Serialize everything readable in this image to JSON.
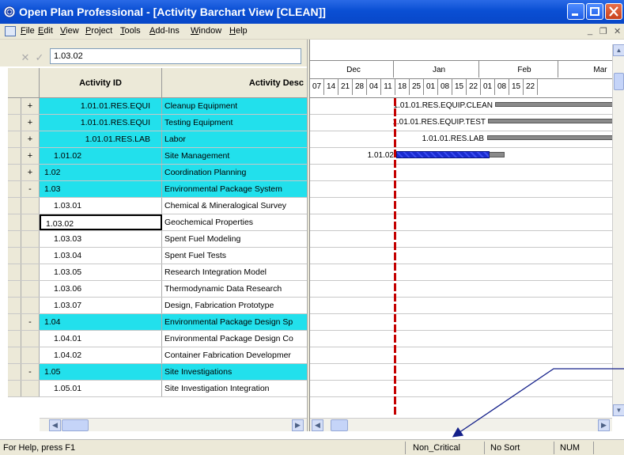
{
  "window": {
    "title": "Open Plan Professional - [Activity Barchart View [CLEAN]]"
  },
  "menu": [
    "File",
    "Edit",
    "View",
    "Project",
    "Tools",
    "Add-Ins",
    "Window",
    "Help"
  ],
  "editbar": {
    "cancel_icon": "x-icon",
    "confirm_icon": "check-icon",
    "value": "1.03.02"
  },
  "grid": {
    "headers": {
      "id": "Activity ID",
      "desc": "Activity Desc"
    },
    "rows": [
      {
        "expander": "+",
        "id": "1.01.01.RES.EQUI",
        "desc": "Cleanup Equipment",
        "style": "cyan",
        "indent": 2,
        "align": "right"
      },
      {
        "expander": "+",
        "id": "1.01.01.RES.EQUI",
        "desc": "Testing Equipment",
        "style": "cyan",
        "indent": 2,
        "align": "right"
      },
      {
        "expander": "+",
        "id": "1.01.01.RES.LAB",
        "desc": "Labor",
        "style": "cyan",
        "indent": 2,
        "align": "right"
      },
      {
        "expander": "+",
        "id": "1.01.02",
        "desc": "Site Management",
        "style": "cyan",
        "indent": 1,
        "align": "left"
      },
      {
        "expander": "+",
        "id": "1.02",
        "desc": "Coordination Planning",
        "style": "cyan",
        "indent": 0,
        "align": "left"
      },
      {
        "expander": "-",
        "id": "1.03",
        "desc": "Environmental Package System",
        "style": "cyan",
        "indent": 0,
        "align": "left"
      },
      {
        "expander": "",
        "id": "1.03.01",
        "desc": "Chemical & Mineralogical Survey",
        "style": "white",
        "indent": 1,
        "align": "left"
      },
      {
        "expander": "",
        "id": "1.03.02",
        "desc": "Geochemical Properties",
        "style": "white",
        "indent": 0,
        "align": "left",
        "editing": true
      },
      {
        "expander": "",
        "id": "1.03.03",
        "desc": "Spent Fuel Modeling",
        "style": "white",
        "indent": 1,
        "align": "left"
      },
      {
        "expander": "",
        "id": "1.03.04",
        "desc": "Spent Fuel Tests",
        "style": "white",
        "indent": 1,
        "align": "left"
      },
      {
        "expander": "",
        "id": "1.03.05",
        "desc": "Research Integration Model",
        "style": "white",
        "indent": 1,
        "align": "left"
      },
      {
        "expander": "",
        "id": "1.03.06",
        "desc": "Thermodynamic Data Research",
        "style": "white",
        "indent": 1,
        "align": "left"
      },
      {
        "expander": "",
        "id": "1.03.07",
        "desc": "Design, Fabrication Prototype",
        "style": "white",
        "indent": 1,
        "align": "left"
      },
      {
        "expander": "-",
        "id": "1.04",
        "desc": "Environmental Package Design Sp",
        "style": "cyan",
        "indent": 0,
        "align": "left"
      },
      {
        "expander": "",
        "id": "1.04.01",
        "desc": "Environmental Package Design Co",
        "style": "white",
        "indent": 1,
        "align": "left"
      },
      {
        "expander": "",
        "id": "1.04.02",
        "desc": "Container Fabrication Developmer",
        "style": "white",
        "indent": 1,
        "align": "left"
      },
      {
        "expander": "-",
        "id": "1.05",
        "desc": "Site Investigations",
        "style": "cyan",
        "indent": 0,
        "align": "left"
      },
      {
        "expander": "",
        "id": "1.05.01",
        "desc": "Site Investigation Integration",
        "style": "white",
        "indent": 1,
        "align": "left"
      }
    ]
  },
  "gantt": {
    "months": [
      "Dec",
      "Jan",
      "Feb",
      "Mar"
    ],
    "weeks": [
      "07",
      "14",
      "21",
      "28",
      "04",
      "11",
      "18",
      "25",
      "01",
      "08",
      "15",
      "22",
      "01",
      "08",
      "15",
      "22"
    ],
    "bars": [
      {
        "row": 0,
        "label": "1.01.01.RES.EQUIP.CLEAN",
        "style": "gray"
      },
      {
        "row": 1,
        "label": "1.01.01.RES.EQUIP.TEST",
        "style": "gray"
      },
      {
        "row": 2,
        "label": "1.01.01.RES.LAB",
        "style": "gray"
      },
      {
        "row": 3,
        "label": "1.01.02",
        "style": "blue-progress"
      }
    ]
  },
  "status": {
    "help": "For Help, press F1",
    "criticality": "Non_Critical",
    "sort": "No Sort",
    "num": "NUM"
  },
  "colors": {
    "cyan": "#22e0ec",
    "titlebar": "#0a4fd4",
    "dataline": "#c40000",
    "progress": "#1a2bd0"
  }
}
